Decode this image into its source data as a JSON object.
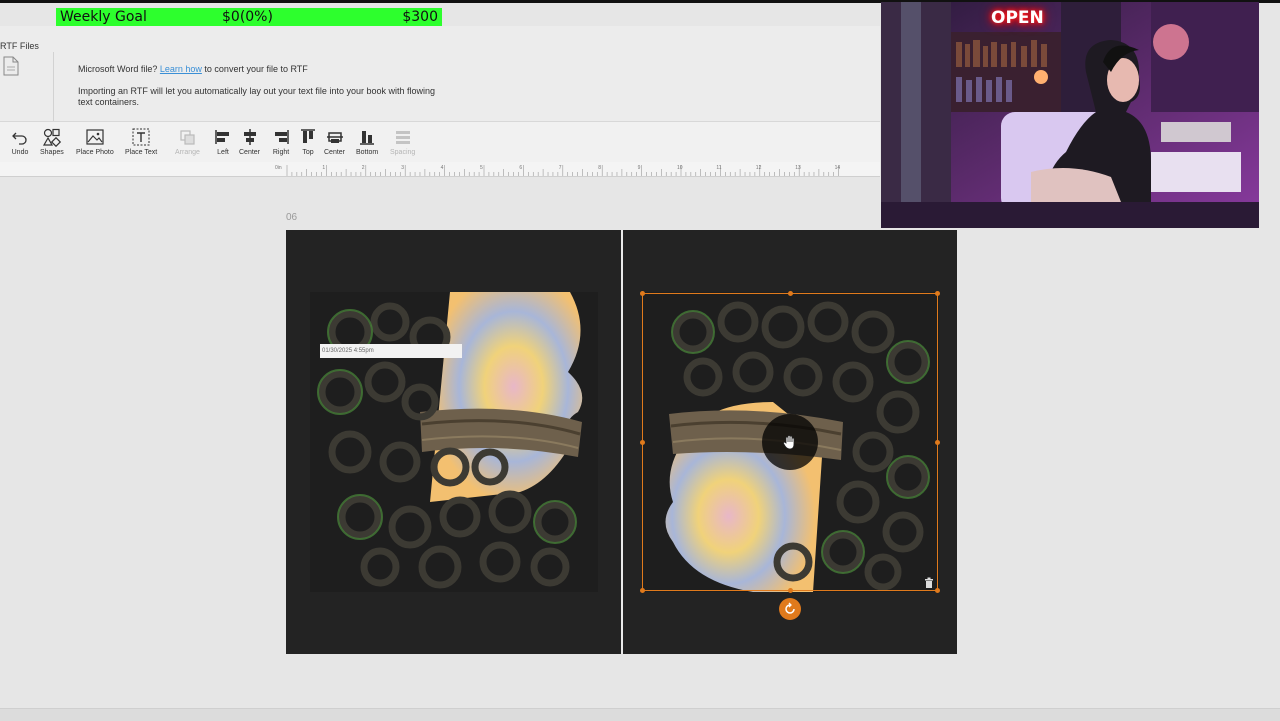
{
  "goal": {
    "label": "Weekly Goal",
    "current": "$0(0%)",
    "target": "$300",
    "progress": 0
  },
  "import_panel": {
    "section_label": "RTF Files",
    "line1_prefix": "Microsoft Word file?",
    "line1_link": "Learn how",
    "line1_suffix": "to convert your file to RTF",
    "line2": "Importing an RTF will let you automatically lay out your text file into your book with flowing text containers."
  },
  "toolbar": {
    "undo": "Undo",
    "shapes": "Shapes",
    "place_photo": "Place Photo",
    "place_text": "Place Text",
    "arrange": "Arrange",
    "left": "Left",
    "center_h": "Center",
    "right": "Right",
    "top": "Top",
    "center_v": "Center",
    "bottom": "Bottom",
    "spacing": "Spacing"
  },
  "ruler": {
    "origin_label": "0in",
    "labels": [
      "1",
      "2",
      "3",
      "4",
      "5",
      "6",
      "7",
      "8",
      "9",
      "10",
      "11",
      "12",
      "13",
      "14"
    ]
  },
  "canvas": {
    "page_number": "06",
    "timestamp": "01/30/2025 4:55pm"
  },
  "webcam": {
    "sign_text": "OPEN"
  },
  "colors": {
    "goal_bar": "#2dff2d",
    "selection": "#e07a1c",
    "link": "#3a8fd6"
  }
}
